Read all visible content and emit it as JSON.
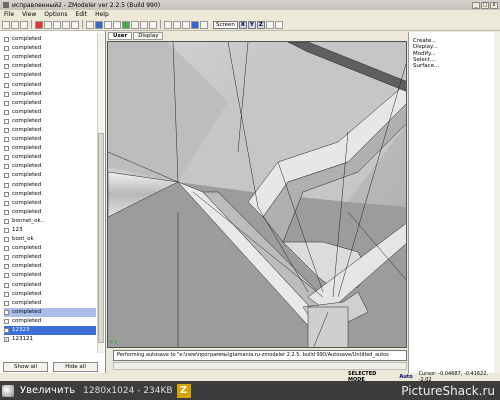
{
  "window": {
    "title": "исправленный2 - ZModeler ver 2.2.5 (Build 990)",
    "min": "_",
    "max": "□",
    "close": "x"
  },
  "menu": [
    "File",
    "View",
    "Options",
    "Edit",
    "Help"
  ],
  "toolbar": {
    "screen_label": "Screen",
    "axes": [
      "X",
      "Y",
      "Z"
    ]
  },
  "objects": [
    {
      "label": "completed",
      "checked": false,
      "state": ""
    },
    {
      "label": "completed",
      "checked": false,
      "state": ""
    },
    {
      "label": "completed",
      "checked": false,
      "state": ""
    },
    {
      "label": "completed",
      "checked": false,
      "state": ""
    },
    {
      "label": "completed",
      "checked": false,
      "state": ""
    },
    {
      "label": "completed",
      "checked": false,
      "state": ""
    },
    {
      "label": "completed",
      "checked": false,
      "state": ""
    },
    {
      "label": "completed",
      "checked": false,
      "state": ""
    },
    {
      "label": "completed",
      "checked": false,
      "state": ""
    },
    {
      "label": "completed",
      "checked": false,
      "state": ""
    },
    {
      "label": "completed",
      "checked": false,
      "state": ""
    },
    {
      "label": "completed",
      "checked": false,
      "state": ""
    },
    {
      "label": "completed",
      "checked": false,
      "state": ""
    },
    {
      "label": "completed",
      "checked": false,
      "state": ""
    },
    {
      "label": "completed",
      "checked": false,
      "state": ""
    },
    {
      "label": "completed",
      "checked": false,
      "state": ""
    },
    {
      "label": "completed",
      "checked": false,
      "state": ""
    },
    {
      "label": "completed",
      "checked": false,
      "state": ""
    },
    {
      "label": "completed",
      "checked": false,
      "state": ""
    },
    {
      "label": "completed",
      "checked": false,
      "state": ""
    },
    {
      "label": "bonnet_ok..",
      "checked": false,
      "state": ""
    },
    {
      "label": "123",
      "checked": false,
      "state": ""
    },
    {
      "label": "boot_ok",
      "checked": false,
      "state": ""
    },
    {
      "label": "completed",
      "checked": false,
      "state": ""
    },
    {
      "label": "completed",
      "checked": false,
      "state": ""
    },
    {
      "label": "completed",
      "checked": false,
      "state": ""
    },
    {
      "label": "completed",
      "checked": false,
      "state": ""
    },
    {
      "label": "completed",
      "checked": false,
      "state": ""
    },
    {
      "label": "completed",
      "checked": false,
      "state": ""
    },
    {
      "label": "completed",
      "checked": false,
      "state": ""
    },
    {
      "label": "completed",
      "checked": false,
      "state": "sel2"
    },
    {
      "label": "completed",
      "checked": false,
      "state": ""
    },
    {
      "label": "12323",
      "checked": true,
      "state": "sel"
    },
    {
      "label": "123121",
      "checked": true,
      "state": ""
    }
  ],
  "buttons": {
    "show_all": "Show all",
    "hide_all": "Hide all"
  },
  "tabs": [
    "User",
    "Display"
  ],
  "right_menu": [
    "Create...",
    "Display...",
    "Modify...",
    "Select...",
    "Surface..."
  ],
  "status_text": "Performing autosave to \"e:\\new\\программы\\gtamania.ru-zmodeler 2.2.5. build 990/Autosave/Untitled_autos",
  "bottom": {
    "mode": "SELECTED MODE",
    "auto": "Auto",
    "cursor": "Cursor: -0.04687, -0.41622, -2.02"
  },
  "viewport_axis": "x y",
  "taskbar": {
    "enlarge": "Увеличить",
    "resolution": "1280x1024 - 234KB",
    "zm": "Z",
    "brand": "PictureShack.ru"
  }
}
